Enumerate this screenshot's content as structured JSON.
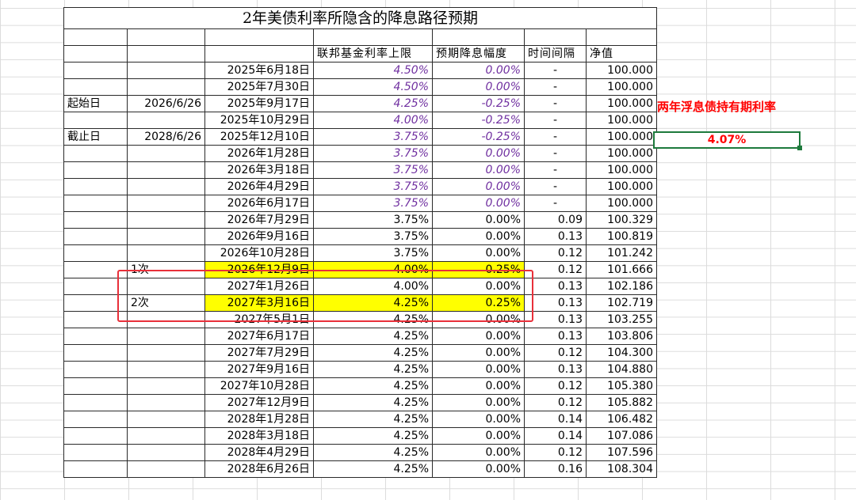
{
  "title": "2年美债利率所隐含的降息路径预期",
  "headers": [
    "联邦基金利率上限",
    "预期降息幅度",
    "时间间隔",
    "净值"
  ],
  "start_label": "起始日",
  "start_date": "2026/6/26",
  "end_label": "截止日",
  "end_date": "2028/6/26",
  "annotation_1": "1次",
  "annotation_2": "2次",
  "side_label": "两年浮息债持有期利率",
  "side_value": "4.07%",
  "colors": {
    "purple": "#7030a0",
    "highlight": "#ffff00",
    "red": "#ff0000",
    "frame": "#e8303a",
    "selection": "#1d7a3c"
  },
  "rows": [
    {
      "date": "2025年6月18日",
      "rate": "4.50%",
      "cut": "0.00%",
      "interval": "-",
      "nav": "100.000",
      "style": "purple"
    },
    {
      "date": "2025年7月30日",
      "rate": "4.50%",
      "cut": "0.00%",
      "interval": "-",
      "nav": "100.000",
      "style": "purple"
    },
    {
      "date": "2025年9月17日",
      "rate": "4.25%",
      "cut": "-0.25%",
      "interval": "-",
      "nav": "100.000",
      "style": "purple"
    },
    {
      "date": "2025年10月29日",
      "rate": "4.00%",
      "cut": "-0.25%",
      "interval": "-",
      "nav": "100.000",
      "style": "purple"
    },
    {
      "date": "2025年12月10日",
      "rate": "3.75%",
      "cut": "-0.25%",
      "interval": "-",
      "nav": "100.000",
      "style": "purple"
    },
    {
      "date": "2026年1月28日",
      "rate": "3.75%",
      "cut": "0.00%",
      "interval": "-",
      "nav": "100.000",
      "style": "purple"
    },
    {
      "date": "2026年3月18日",
      "rate": "3.75%",
      "cut": "0.00%",
      "interval": "-",
      "nav": "100.000",
      "style": "purple"
    },
    {
      "date": "2026年4月29日",
      "rate": "3.75%",
      "cut": "0.00%",
      "interval": "-",
      "nav": "100.000",
      "style": "purple"
    },
    {
      "date": "2026年6月17日",
      "rate": "3.75%",
      "cut": "0.00%",
      "interval": "-",
      "nav": "100.000",
      "style": "purple"
    },
    {
      "date": "2026年7月29日",
      "rate": "3.75%",
      "cut": "0.00%",
      "interval": "0.09",
      "nav": "100.329",
      "style": "normal"
    },
    {
      "date": "2026年9月16日",
      "rate": "3.75%",
      "cut": "0.00%",
      "interval": "0.13",
      "nav": "100.819",
      "style": "normal"
    },
    {
      "date": "2026年10月28日",
      "rate": "3.75%",
      "cut": "0.00%",
      "interval": "0.12",
      "nav": "101.242",
      "style": "normal"
    },
    {
      "date": "2026年12月9日",
      "rate": "4.00%",
      "cut": "0.25%",
      "interval": "0.12",
      "nav": "101.666",
      "style": "highlight"
    },
    {
      "date": "2027年1月26日",
      "rate": "4.00%",
      "cut": "0.00%",
      "interval": "0.13",
      "nav": "102.186",
      "style": "normal"
    },
    {
      "date": "2027年3月16日",
      "rate": "4.25%",
      "cut": "0.25%",
      "interval": "0.13",
      "nav": "102.719",
      "style": "highlight"
    },
    {
      "date": "2027年5月1日",
      "rate": "4.25%",
      "cut": "0.00%",
      "interval": "0.13",
      "nav": "103.255",
      "style": "normal"
    },
    {
      "date": "2027年6月17日",
      "rate": "4.25%",
      "cut": "0.00%",
      "interval": "0.13",
      "nav": "103.806",
      "style": "normal"
    },
    {
      "date": "2027年7月29日",
      "rate": "4.25%",
      "cut": "0.00%",
      "interval": "0.12",
      "nav": "104.300",
      "style": "normal"
    },
    {
      "date": "2027年9月16日",
      "rate": "4.25%",
      "cut": "0.00%",
      "interval": "0.13",
      "nav": "104.880",
      "style": "normal"
    },
    {
      "date": "2027年10月28日",
      "rate": "4.25%",
      "cut": "0.00%",
      "interval": "0.12",
      "nav": "105.380",
      "style": "normal"
    },
    {
      "date": "2027年12月9日",
      "rate": "4.25%",
      "cut": "0.00%",
      "interval": "0.12",
      "nav": "105.882",
      "style": "normal"
    },
    {
      "date": "2028年1月28日",
      "rate": "4.25%",
      "cut": "0.00%",
      "interval": "0.14",
      "nav": "106.482",
      "style": "normal"
    },
    {
      "date": "2028年3月18日",
      "rate": "4.25%",
      "cut": "0.00%",
      "interval": "0.14",
      "nav": "107.086",
      "style": "normal"
    },
    {
      "date": "2028年4月29日",
      "rate": "4.25%",
      "cut": "0.00%",
      "interval": "0.12",
      "nav": "107.596",
      "style": "normal"
    },
    {
      "date": "2028年6月26日",
      "rate": "4.25%",
      "cut": "0.00%",
      "interval": "0.16",
      "nav": "108.304",
      "style": "normal"
    }
  ]
}
